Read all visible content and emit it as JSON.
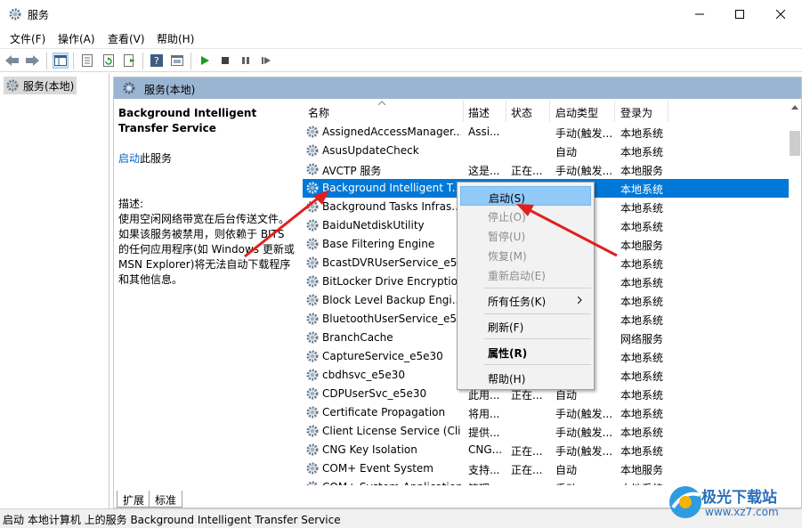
{
  "window": {
    "title": "服务",
    "controls": [
      "minimize",
      "maximize",
      "close"
    ]
  },
  "menu": [
    "文件(F)",
    "操作(A)",
    "查看(V)",
    "帮助(H)"
  ],
  "toolbar_icons": [
    "back-icon",
    "forward-icon",
    "show-hide-tree-icon",
    "properties-icon",
    "refresh-icon",
    "export-icon",
    "help-icon",
    "console-icon",
    "start-icon",
    "stop-icon",
    "pause-icon",
    "restart-icon"
  ],
  "tree": {
    "root_label": "服务(本地)"
  },
  "pane": {
    "header": "服务(本地)",
    "service_title": "Background Intelligent Transfer Service",
    "start_link": "启动",
    "start_suffix": "此服务",
    "desc_label": "描述:",
    "desc_text": "使用空闲网络带宽在后台传送文件。如果该服务被禁用，则依赖于 BITS 的任何应用程序(如 Windows 更新或 MSN Explorer)将无法自动下载程序和其他信息。"
  },
  "columns": {
    "name": "名称",
    "desc": "描述",
    "status": "状态",
    "startup": "启动类型",
    "logon": "登录为"
  },
  "rows": [
    {
      "name": "AssignedAccessManager...",
      "desc": "Assi...",
      "status": "",
      "startup": "手动(触发...",
      "logon": "本地系统"
    },
    {
      "name": "AsusUpdateCheck",
      "desc": "",
      "status": "",
      "startup": "自动",
      "logon": "本地系统"
    },
    {
      "name": "AVCTP 服务",
      "desc": "这是...",
      "status": "正在...",
      "startup": "手动(触发...",
      "logon": "本地服务"
    },
    {
      "name": "Background Intelligent T...",
      "desc": "",
      "status": "",
      "startup": "",
      "logon": "本地系统"
    },
    {
      "name": "Background Tasks Infras...",
      "desc": "",
      "status": "",
      "startup": "",
      "logon": "本地系统"
    },
    {
      "name": "BaiduNetdiskUtility",
      "desc": "",
      "status": "",
      "startup": "",
      "logon": "本地系统"
    },
    {
      "name": "Base Filtering Engine",
      "desc": "",
      "status": "",
      "startup": "",
      "logon": "本地服务"
    },
    {
      "name": "BcastDVRUserService_e5...",
      "desc": "",
      "status": "",
      "startup": "",
      "logon": "本地系统"
    },
    {
      "name": "BitLocker Drive Encryptio...",
      "desc": "",
      "status": "",
      "startup": "",
      "logon": "本地系统"
    },
    {
      "name": "Block Level Backup Engi...",
      "desc": "",
      "status": "",
      "startup": "",
      "logon": "本地系统"
    },
    {
      "name": "BluetoothUserService_e5...",
      "desc": "",
      "status": "",
      "startup": "",
      "logon": "本地系统"
    },
    {
      "name": "BranchCache",
      "desc": "",
      "status": "",
      "startup": "",
      "logon": "网络服务"
    },
    {
      "name": "CaptureService_e5e30",
      "desc": "",
      "status": "",
      "startup": "",
      "logon": "本地系统"
    },
    {
      "name": "cbdhsvc_e5e30",
      "desc": "",
      "status": "",
      "startup": "",
      "logon": "本地系统"
    },
    {
      "name": "CDPUserSvc_e5e30",
      "desc": "此用...",
      "status": "正在...",
      "startup": "自动",
      "logon": "本地系统"
    },
    {
      "name": "Certificate Propagation",
      "desc": "将用...",
      "status": "",
      "startup": "手动(触发...",
      "logon": "本地系统"
    },
    {
      "name": "Client License Service (Cli...",
      "desc": "提供...",
      "status": "",
      "startup": "手动(触发...",
      "logon": "本地系统"
    },
    {
      "name": "CNG Key Isolation",
      "desc": "CNG...",
      "status": "正在...",
      "startup": "手动(触发...",
      "logon": "本地系统"
    },
    {
      "name": "COM+ Event System",
      "desc": "支持...",
      "status": "正在...",
      "startup": "自动",
      "logon": "本地服务"
    },
    {
      "name": "COM+ System Application",
      "desc": "管理...",
      "status": "",
      "startup": "手动",
      "logon": "本地系统"
    }
  ],
  "context_menu": {
    "start": "启动(S)",
    "stop": "停止(O)",
    "pause": "暂停(U)",
    "resume": "恢复(M)",
    "restart": "重新启动(E)",
    "all_tasks": "所有任务(K)",
    "refresh": "刷新(F)",
    "properties": "属性(R)",
    "help": "帮助(H)"
  },
  "tabs": [
    "扩展",
    "标准"
  ],
  "status_text": "启动 本地计算机 上的服务 Background Intelligent Transfer Service",
  "watermark": {
    "name": "极光下载站",
    "url": "www.xz7.com"
  },
  "colors": {
    "selection": "#0078d7",
    "pane_header": "#9ab5d1",
    "menu_highlight": "#91c9f7",
    "arrow": "#e02020"
  }
}
